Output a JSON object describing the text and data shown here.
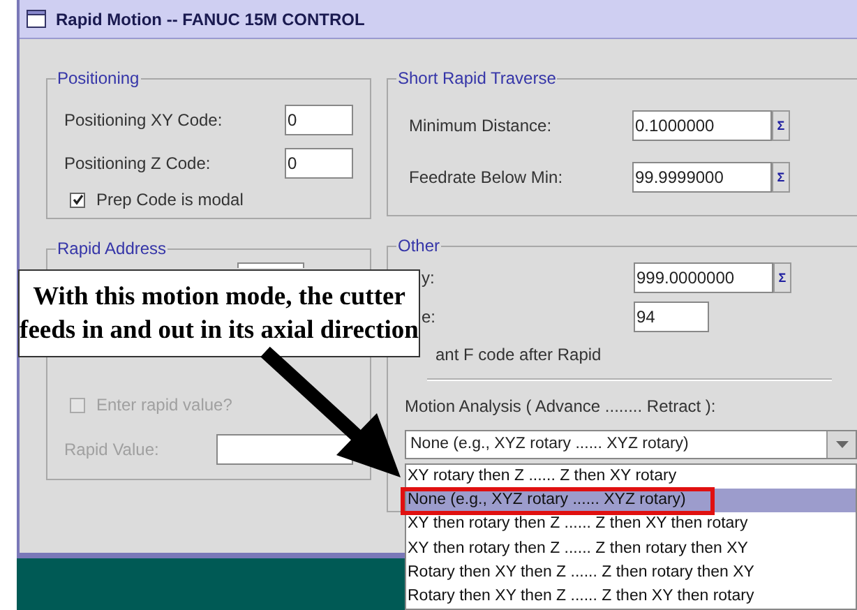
{
  "window": {
    "title": "Rapid Motion -- FANUC 15M CONTROL"
  },
  "positioning": {
    "title": "Positioning",
    "fields": [
      {
        "label": "Positioning XY Code:",
        "value": "0"
      },
      {
        "label": "Positioning Z Code:",
        "value": "0"
      }
    ],
    "checkbox": {
      "label": "Prep Code is modal",
      "checked": true
    }
  },
  "rapid_address": {
    "title": "Rapid Address",
    "checkbox": {
      "label": "Enter rapid value?",
      "checked": false,
      "disabled": true
    },
    "field": {
      "label": "Rapid Value:",
      "disabled": true
    }
  },
  "short_rapid_traverse": {
    "title": "Short Rapid Traverse",
    "fields": [
      {
        "label": "Minimum Distance:",
        "value": "0.1000000",
        "button": "Σ"
      },
      {
        "label": "Feedrate Below Min:",
        "value": "99.9999000",
        "button": "Σ"
      }
    ]
  },
  "other": {
    "title": "Other",
    "fields": [
      {
        "label": "y:",
        "value": "999.0000000",
        "button": "Σ"
      },
      {
        "label": "e:",
        "value": "94"
      }
    ],
    "checkbox_label": "ant F code after Rapid",
    "motion_label": "Motion Analysis ( Advance ........ Retract ):",
    "combo": {
      "value": "None (e.g., XYZ rotary ...... XYZ rotary)",
      "options": [
        {
          "label": "XY rotary then Z ...... Z then XY rotary",
          "selected": false
        },
        {
          "label": "None (e.g., XYZ rotary ...... XYZ rotary)",
          "selected": true
        },
        {
          "label": "XY then rotary then Z ...... Z then XY then rotary",
          "selected": false
        },
        {
          "label": "XY then rotary then Z ...... Z then rotary then XY",
          "selected": false
        },
        {
          "label": "Rotary then XY then Z ...... Z then rotary then XY",
          "selected": false
        },
        {
          "label": "Rotary then XY then Z ...... Z then XY then rotary",
          "selected": false
        }
      ]
    }
  },
  "callout": {
    "lines": [
      "With this motion mode, the cutter",
      "feeds in and out in its axial direction"
    ]
  }
}
